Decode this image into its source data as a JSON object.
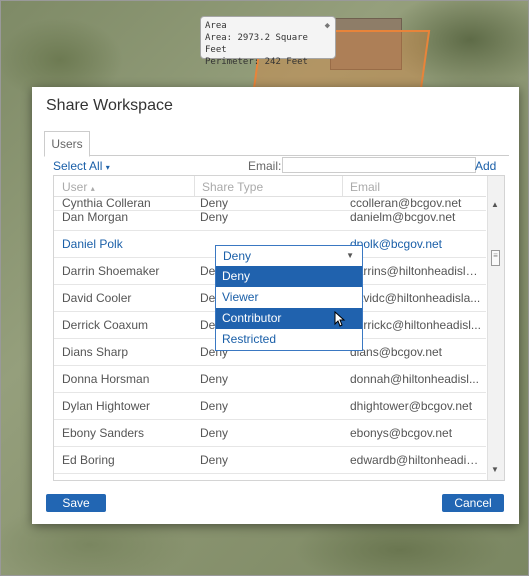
{
  "tooltip": {
    "title": "Area",
    "area": "Area: 2973.2 Square Feet",
    "perimeter": "Perimeter: 242 Feet"
  },
  "dialog": {
    "title": "Share Workspace",
    "tab_users": "Users",
    "select_all": "Select All",
    "email_label": "Email:",
    "email_value": "",
    "add_label": "Add",
    "save_label": "Save",
    "cancel_label": "Cancel"
  },
  "grid": {
    "headers": {
      "user": "User",
      "share_type": "Share Type",
      "email": "Email"
    },
    "rows": [
      {
        "user": "Cynthia Colleran",
        "share": "Deny",
        "email": "ccolleran@bcgov.net"
      },
      {
        "user": "Dan Morgan",
        "share": "Deny",
        "email": "danielm@bcgov.net"
      },
      {
        "user": "Daniel Polk",
        "share": "Deny",
        "email": "dpolk@bcgov.net"
      },
      {
        "user": "Darrin Shoemaker",
        "share": "Deny",
        "email": "darrins@hiltonheadisla..."
      },
      {
        "user": "David Cooler",
        "share": "Deny",
        "email": "davidc@hiltonheadisla..."
      },
      {
        "user": "Derrick Coaxum",
        "share": "Deny",
        "email": "derrickc@hiltonheadisl..."
      },
      {
        "user": "Dians Sharp",
        "share": "Deny",
        "email": "dians@bcgov.net"
      },
      {
        "user": "Donna Horsman",
        "share": "Deny",
        "email": "donnah@hiltonheadisl..."
      },
      {
        "user": "Dylan Hightower",
        "share": "Deny",
        "email": "dhightower@bcgov.net"
      },
      {
        "user": "Ebony Sanders",
        "share": "Deny",
        "email": "ebonys@bcgov.net"
      },
      {
        "user": "Ed Boring",
        "share": "Deny",
        "email": "edwardb@hiltonheadisl..."
      }
    ]
  },
  "dropdown": {
    "selected": "Deny",
    "options": [
      "Deny",
      "Viewer",
      "Contributor",
      "Restricted"
    ]
  },
  "colors": {
    "accent": "#2266b3",
    "link": "#1a5fa8",
    "highlight": "#2062ae"
  }
}
